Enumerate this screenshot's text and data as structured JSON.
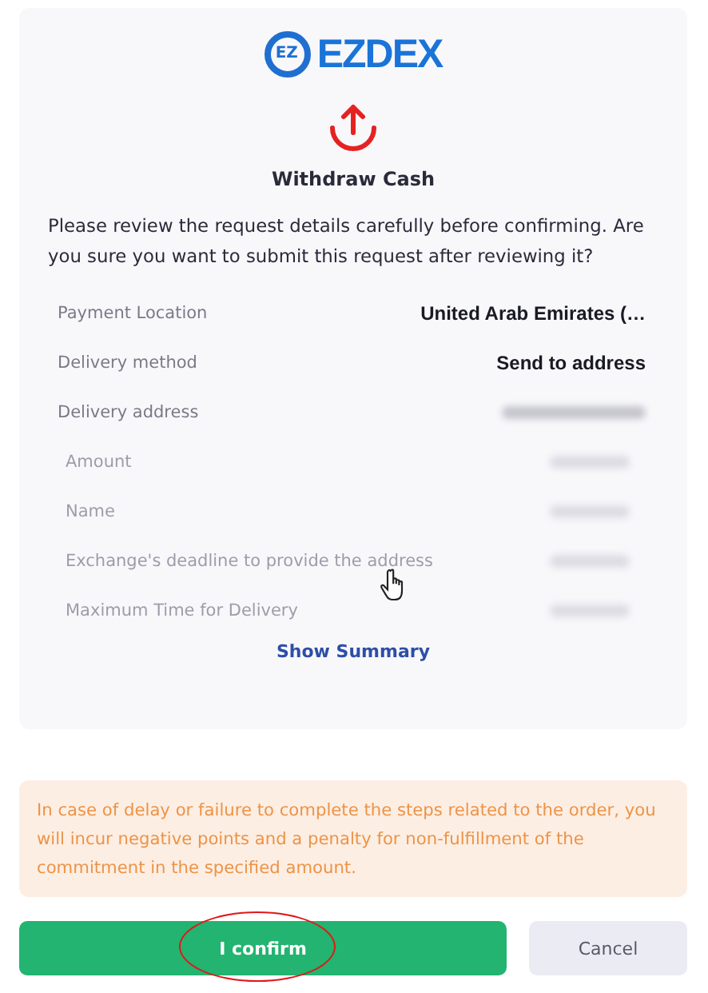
{
  "logo": {
    "badge": "EZ",
    "wordmark": "EZDEX"
  },
  "title": "Withdraw Cash",
  "prompt": "Please review the request details carefully before confirming. Are you sure you want to submit this request after reviewing it?",
  "details": [
    {
      "label": "Payment Location",
      "value": "United Arab Emirates (…",
      "blurred": false,
      "faded": false
    },
    {
      "label": "Delivery method",
      "value": "Send to address",
      "blurred": false,
      "faded": false
    },
    {
      "label": "Delivery address",
      "blurred": true,
      "faded": false
    },
    {
      "label": "Amount",
      "blurred": true,
      "faded": true
    },
    {
      "label": "Name",
      "blurred": true,
      "faded": true
    },
    {
      "label": "Exchange's deadline to provide the address",
      "blurred": true,
      "faded": true
    },
    {
      "label": "Maximum Time for Delivery",
      "blurred": true,
      "faded": true
    }
  ],
  "show_summary": "Show Summary",
  "warning": "In case of delay or failure to complete the steps related to the order, you will incur negative points and a penalty for non-fulfillment of the commitment in the specified amount.",
  "buttons": [
    {
      "label": "I confirm",
      "kind": "primary",
      "circled": true
    },
    {
      "label": "Cancel",
      "kind": "secondary",
      "circled": false
    }
  ]
}
